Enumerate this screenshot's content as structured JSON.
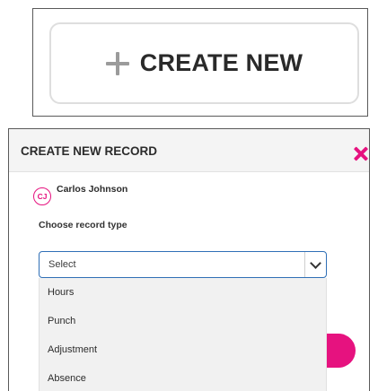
{
  "create_button": {
    "label": "CREATE NEW",
    "icon": "plus-icon"
  },
  "modal": {
    "title": "CREATE NEW RECORD",
    "close_icon": "close-icon",
    "user": {
      "initials": "CJ",
      "name": "Carlos Johnson"
    },
    "field_label": "Choose record type",
    "select": {
      "value": "Select",
      "options": [
        "Hours",
        "Punch",
        "Adjustment",
        "Absence"
      ]
    }
  },
  "colors": {
    "accent": "#e6127f",
    "select_border": "#2f6fb6"
  }
}
